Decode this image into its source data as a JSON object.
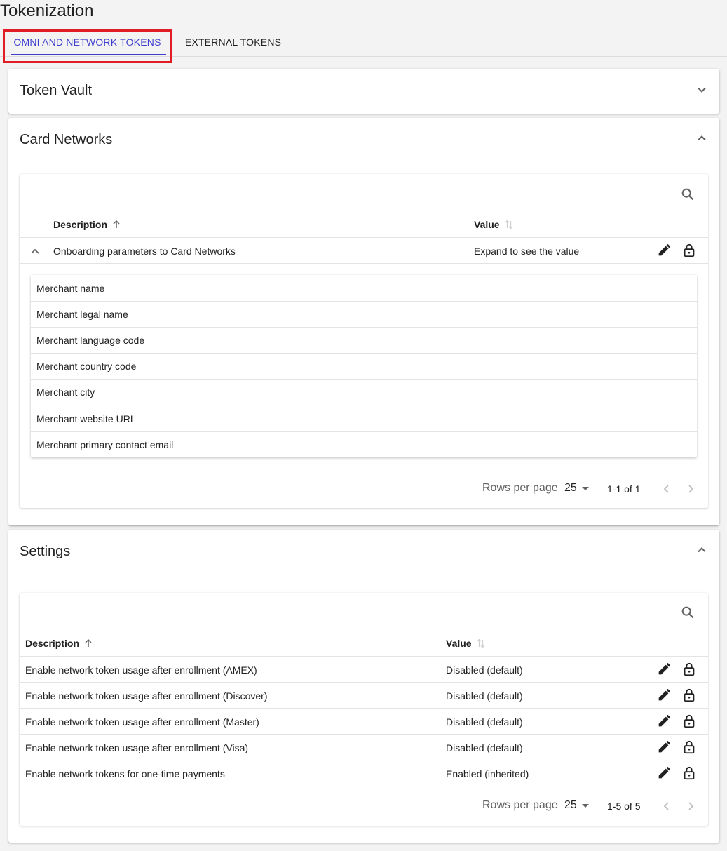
{
  "page": {
    "title": "Tokenization"
  },
  "tabs": [
    {
      "label": "OMNI AND NETWORK TOKENS"
    },
    {
      "label": "EXTERNAL TOKENS"
    }
  ],
  "token_vault": {
    "title": "Token Vault"
  },
  "card_networks": {
    "title": "Card Networks",
    "headers": {
      "description": "Description",
      "value": "Value"
    },
    "row": {
      "description": "Onboarding parameters to Card Networks",
      "value": "Expand to see the value"
    },
    "params": [
      "Merchant name",
      "Merchant legal name",
      "Merchant language code",
      "Merchant country code",
      "Merchant city",
      "Merchant website URL",
      "Merchant primary contact email"
    ],
    "footer": {
      "rows_per_page_label": "Rows per page",
      "rows_per_page": "25",
      "range": "1-1 of 1"
    }
  },
  "settings": {
    "title": "Settings",
    "headers": {
      "description": "Description",
      "value": "Value"
    },
    "rows": [
      {
        "description": "Enable network token usage after enrollment (AMEX)",
        "value": "Disabled (default)"
      },
      {
        "description": "Enable network token usage after enrollment (Discover)",
        "value": "Disabled (default)"
      },
      {
        "description": "Enable network token usage after enrollment (Master)",
        "value": "Disabled (default)"
      },
      {
        "description": "Enable network token usage after enrollment (Visa)",
        "value": "Disabled (default)"
      },
      {
        "description": "Enable network tokens for one-time payments",
        "value": "Enabled (inherited)"
      }
    ],
    "footer": {
      "rows_per_page_label": "Rows per page",
      "rows_per_page": "25",
      "range": "1-5 of 5"
    }
  },
  "colors": {
    "accent": "#3f3fcf",
    "highlight": "#e01d25",
    "background": "#f3f3f3"
  },
  "icons": [
    "chevron-down-icon",
    "chevron-up-icon",
    "search-icon",
    "sort-arrow-up-icon",
    "sort-both-icon",
    "edit-pencil-icon",
    "lock-open-icon",
    "chevron-left-icon",
    "chevron-right-icon",
    "dropdown-arrow-icon"
  ]
}
